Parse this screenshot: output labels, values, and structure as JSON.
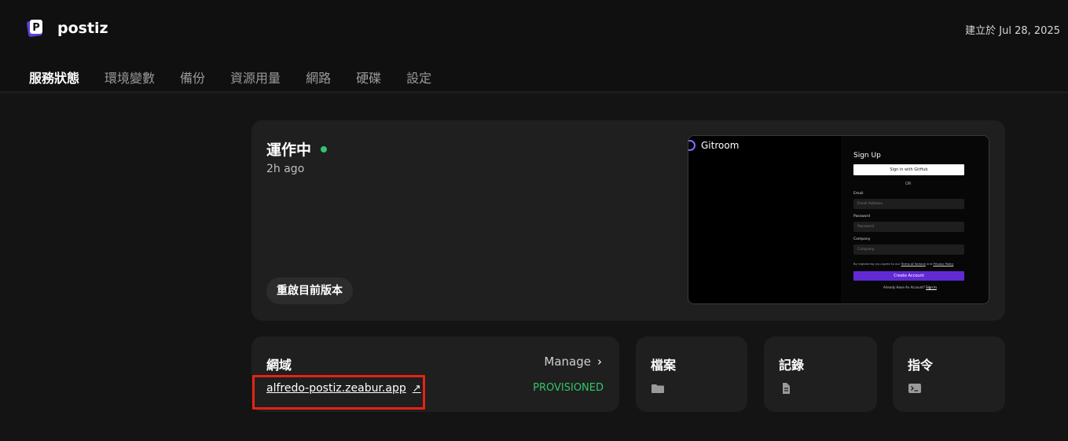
{
  "app": {
    "name": "postiz",
    "logo_letter": "P",
    "created_text": "建立於 Jul 28, 2025"
  },
  "tabs": [
    {
      "label": "服務狀態",
      "active": true
    },
    {
      "label": "環境變數",
      "active": false
    },
    {
      "label": "備份",
      "active": false
    },
    {
      "label": "資源用量",
      "active": false
    },
    {
      "label": "網路",
      "active": false
    },
    {
      "label": "硬碟",
      "active": false
    },
    {
      "label": "設定",
      "active": false
    }
  ],
  "status": {
    "title": "運作中",
    "time": "2h ago",
    "restart_label": "重啟目前版本",
    "dot_color": "#35c46d"
  },
  "preview": {
    "brand": "Gitroom",
    "title": "Sign Up",
    "github_label": "Sign in with GitHub",
    "or_label": "OR",
    "email_label": "Email",
    "email_placeholder": "Email Address",
    "password_label": "Password",
    "password_placeholder": "Password",
    "company_label": "Company",
    "company_placeholder": "Company",
    "terms_prefix": "By registering you agree to our",
    "terms_link": "Terms of Service",
    "terms_and": "and",
    "privacy_link": "Privacy Policy",
    "create_label": "Create Account",
    "login_prefix": "Already Have An Account?",
    "login_link": "Sign In"
  },
  "domain": {
    "title": "網域",
    "manage_label": "Manage",
    "url": "alfredo-postiz.zeabur.app",
    "status": "PROVISIONED"
  },
  "cards": {
    "files": {
      "title": "檔案",
      "icon": "folder-icon"
    },
    "logs": {
      "title": "記錄",
      "icon": "document-icon"
    },
    "command": {
      "title": "指令",
      "icon": "terminal-icon"
    }
  },
  "colors": {
    "accent_green": "#35c46d",
    "highlight_red": "#e52413",
    "create_purple": "#612ad5"
  }
}
